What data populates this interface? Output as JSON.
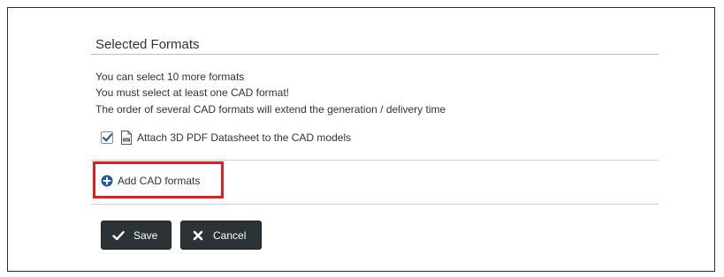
{
  "section": {
    "title": "Selected Formats"
  },
  "info": {
    "line1": "You can select 10 more formats",
    "line2": "You must select at least one CAD format!",
    "line3": "The order of several CAD formats will extend the generation / delivery time"
  },
  "attach": {
    "checked": true,
    "label": "Attach 3D PDF Datasheet to the CAD models",
    "icon": "pdf-file-icon"
  },
  "add_formats": {
    "label": "Add CAD formats",
    "icon": "plus-circle-icon",
    "highlight_color": "#e01e24"
  },
  "buttons": {
    "save_label": "Save",
    "save_icon": "check-icon",
    "cancel_label": "Cancel",
    "cancel_icon": "x-icon",
    "color": "#2b3337"
  },
  "colors": {
    "text": "#333333",
    "accent_blue": "#1f5d9b",
    "checkmark": "#1f5d9b"
  }
}
